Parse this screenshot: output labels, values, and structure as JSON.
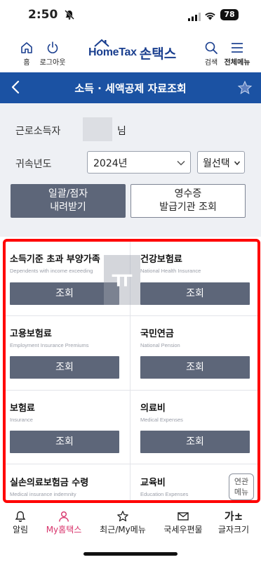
{
  "status_bar": {
    "time": "2:50",
    "battery": "78"
  },
  "top_nav": {
    "home_label": "홈",
    "logout_label": "로그아웃",
    "logo_text_en": "HomeTax",
    "logo_text_ko": "손택스",
    "search_label": "검색",
    "menu_label": "전체메뉴"
  },
  "title_bar": {
    "title": "소득 · 세액공제 자료조회"
  },
  "form": {
    "earner_label": "근로소득자",
    "earner_suffix": "님",
    "year_label": "귀속년도",
    "year_value": "2024년",
    "month_select_value": "월선택",
    "bulk_button": [
      "일괄/점자",
      "내려받기"
    ],
    "issuer_button": [
      "영수증",
      "발급기관 조회"
    ]
  },
  "cards": [
    {
      "title": "소득기준 초과 부양가족",
      "subtitle": "Dependents with income exceeding",
      "button": "조회"
    },
    {
      "title": "건강보험료",
      "subtitle": "National Health Insurance",
      "button": "조회"
    },
    {
      "title": "고용보험료",
      "subtitle": "Employment Insurance Premiums",
      "button": "조회"
    },
    {
      "title": "국민연금",
      "subtitle": "National Pension",
      "button": "조회"
    },
    {
      "title": "보험료",
      "subtitle": "Insurance",
      "button": "조회"
    },
    {
      "title": "의료비",
      "subtitle": "Medical Expenses",
      "button": "조회"
    },
    {
      "title": "실손의료보험금 수령",
      "subtitle": "Medical insurance indemnity"
    },
    {
      "title": "교육비",
      "subtitle": "Education Expenses"
    }
  ],
  "watermark": "ㅠ",
  "related_menu": [
    "연관",
    "메뉴"
  ],
  "tab_bar": [
    {
      "label": "알림",
      "icon": "bell-icon"
    },
    {
      "label": "My홈택스",
      "icon": "person-icon",
      "active": true
    },
    {
      "label": "최근/My메뉴",
      "icon": "star-icon"
    },
    {
      "label": "국세우편물",
      "icon": "mail-icon"
    },
    {
      "label": "글자크기",
      "icon": "text-size-icon",
      "glyph": "가±"
    }
  ],
  "colors": {
    "brand_blue": "#1b52a3",
    "button_gray": "#5d6679",
    "active_tab": "#d8336b",
    "highlight": "#ff0000"
  }
}
